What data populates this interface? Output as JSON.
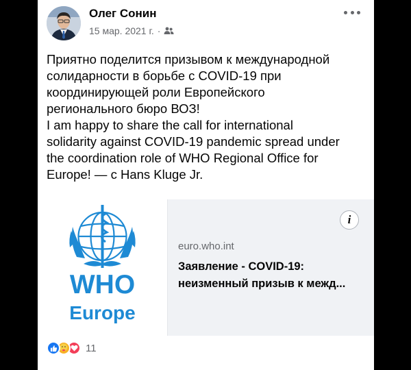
{
  "post": {
    "author": "Олег Сонин",
    "date": "15 мар. 2021 г.",
    "separator": "·",
    "audience_icon": "friends-icon",
    "text_ru": "Приятно поделится призывом к международной\nсолидарности в борьбе с COVID-19 при\nкоординирующей роли Европейского\nрегионального бюро ВОЗ!",
    "text_en": "I am happy to share the call for international\nsolidarity against COVID-19 pandemic spread under\nthe coordination role of WHO Regional Office for\nEurope! — с ",
    "tagged": "Hans Kluge Jr."
  },
  "link_preview": {
    "logo_text": "WHO",
    "logo_subtext": "Europe",
    "domain": "euro.who.int",
    "title_line1": "Заявление - COVID-19:",
    "title_line2": "неизменный призыв к межд..."
  },
  "reactions": {
    "types": [
      "like",
      "care",
      "love"
    ],
    "count": "11"
  },
  "colors": {
    "who_blue": "#1e8ad4",
    "like": "#1877f2",
    "love": "#f33e58",
    "care": "#f7b125"
  }
}
